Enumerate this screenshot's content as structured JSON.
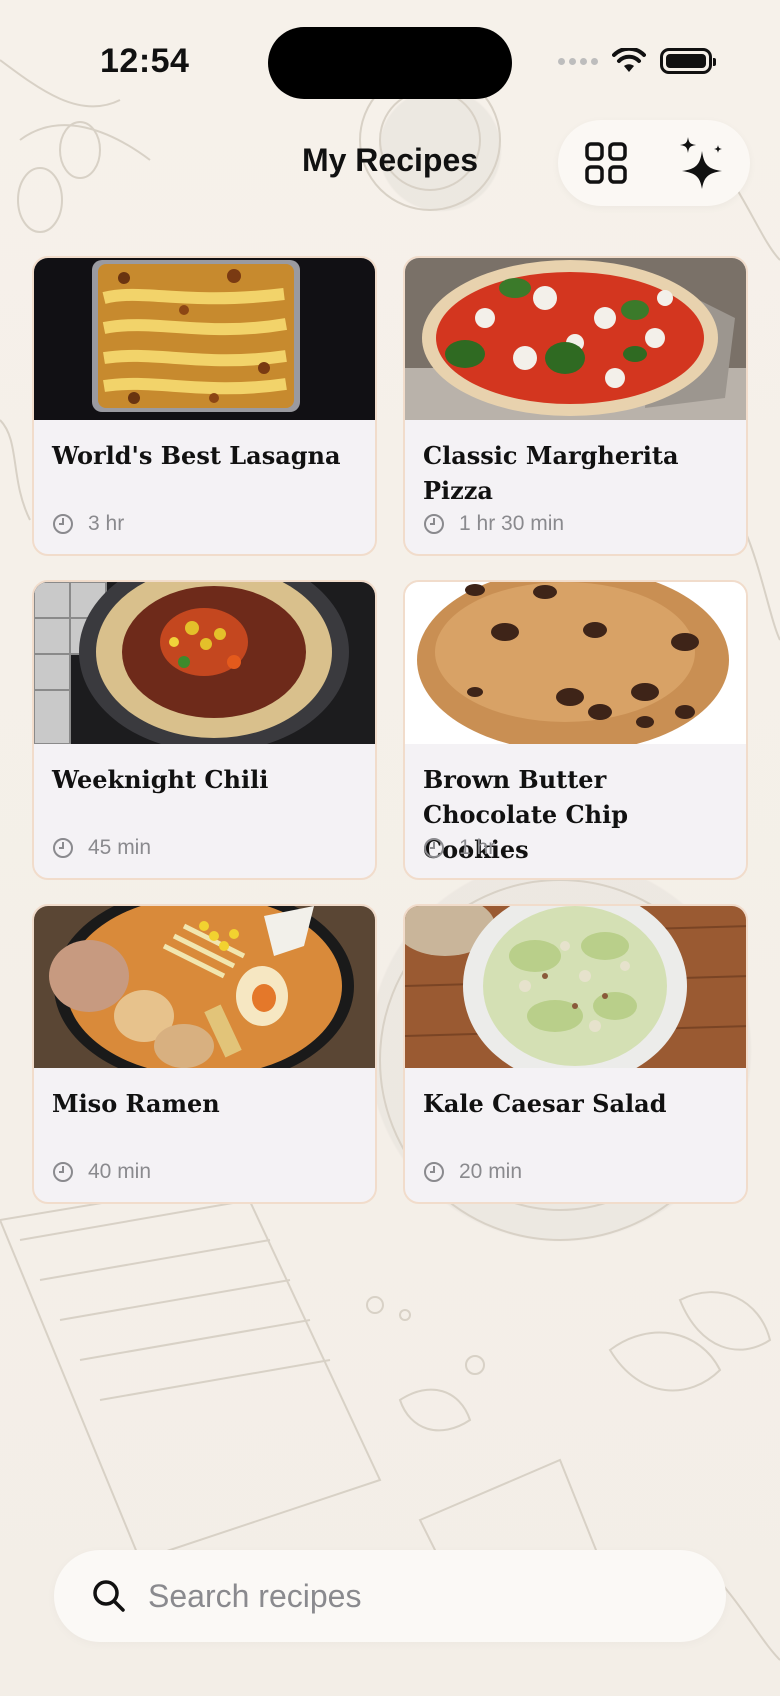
{
  "status_bar": {
    "time": "12:54"
  },
  "header": {
    "title": "My Recipes",
    "grid_icon": "grid-icon",
    "sparkle_icon": "sparkle-icon"
  },
  "recipes": [
    {
      "title": "World's Best Lasagna",
      "time": "3 hr",
      "image": "lasagna"
    },
    {
      "title": "Classic Margherita Pizza",
      "time": "1 hr 30 min",
      "image": "pizza"
    },
    {
      "title": "Weeknight Chili",
      "time": "45 min",
      "image": "chili"
    },
    {
      "title": "Brown Butter Chocolate Chip Cookies",
      "time": "1 hr",
      "image": "cookie"
    },
    {
      "title": "Miso Ramen",
      "time": "40 min",
      "image": "ramen"
    },
    {
      "title": "Kale Caesar Salad",
      "time": "20 min",
      "image": "salad"
    }
  ],
  "search": {
    "placeholder": "Search recipes",
    "value": ""
  },
  "colors": {
    "background": "#f4efe8",
    "card": "#f4f2f5",
    "card_border": "#f1dccb",
    "muted_text": "#8a8a8e"
  }
}
